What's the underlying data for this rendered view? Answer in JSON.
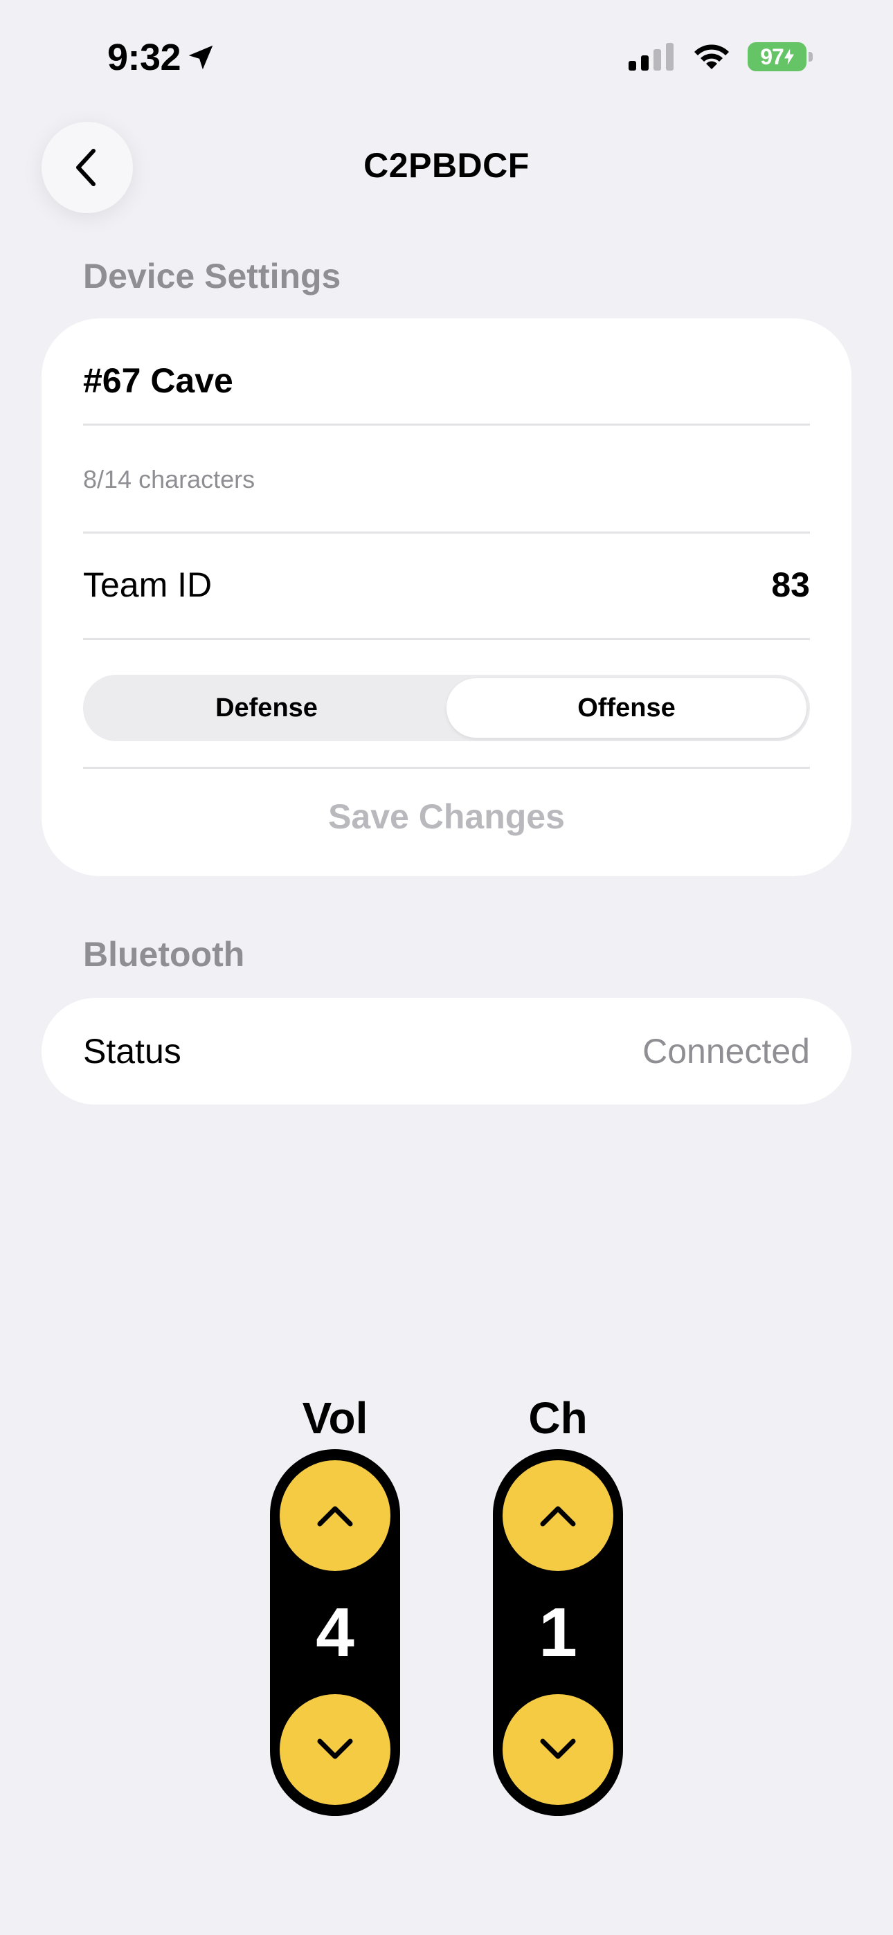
{
  "status_bar": {
    "time": "9:32",
    "battery": "97"
  },
  "nav": {
    "title": "C2PBDCF"
  },
  "device_settings": {
    "header": "Device Settings",
    "name_value": "#67 Cave",
    "char_count": "8/14 characters",
    "team_label": "Team ID",
    "team_value": "83",
    "segments": [
      "Defense",
      "Offense"
    ],
    "selected_segment": "Offense",
    "save_label": "Save Changes"
  },
  "bluetooth": {
    "header": "Bluetooth",
    "status_label": "Status",
    "status_value": "Connected"
  },
  "controls": {
    "vol": {
      "label": "Vol",
      "value": "4"
    },
    "ch": {
      "label": "Ch",
      "value": "1"
    }
  },
  "colors": {
    "accent_yellow": "#f5cb44",
    "battery_green": "#65c466",
    "background": "#f0f0f5"
  }
}
